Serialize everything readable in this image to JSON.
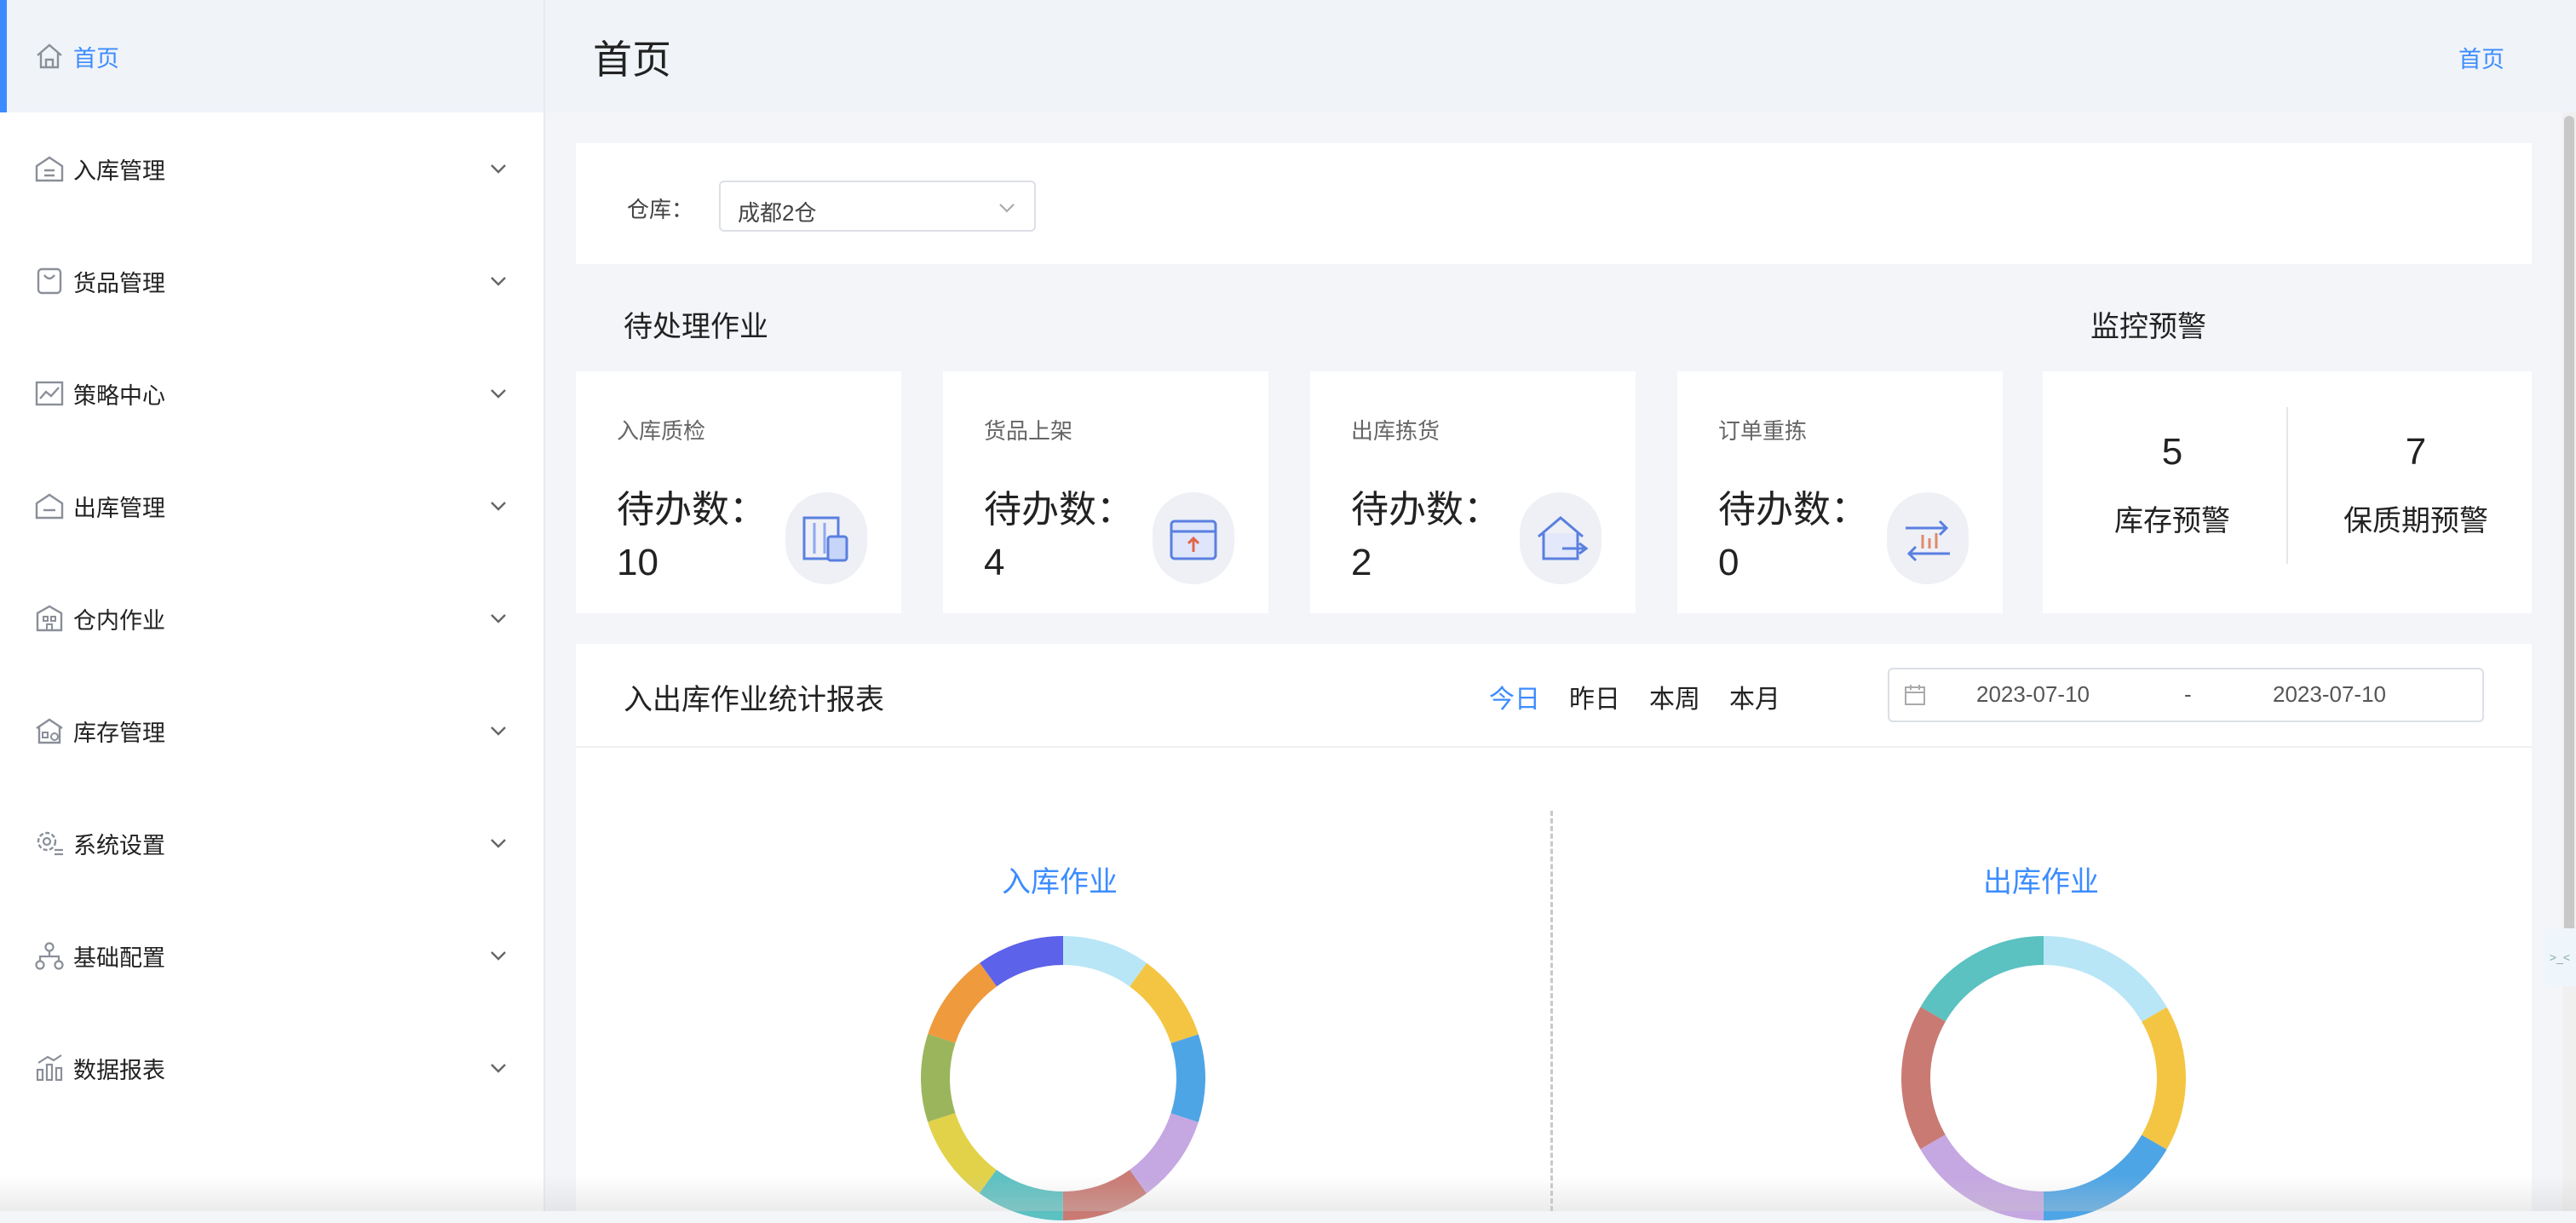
{
  "sidebar": {
    "items": [
      {
        "label": "首页",
        "icon": "home-icon",
        "active": true,
        "has_children": false
      },
      {
        "label": "入库管理",
        "icon": "inbound-icon",
        "active": false,
        "has_children": true
      },
      {
        "label": "货品管理",
        "icon": "bag-icon",
        "active": false,
        "has_children": true
      },
      {
        "label": "策略中心",
        "icon": "chart-line-icon",
        "active": false,
        "has_children": true
      },
      {
        "label": "出库管理",
        "icon": "outbound-icon",
        "active": false,
        "has_children": true
      },
      {
        "label": "仓内作业",
        "icon": "building-icon",
        "active": false,
        "has_children": true
      },
      {
        "label": "库存管理",
        "icon": "warehouse-icon",
        "active": false,
        "has_children": true
      },
      {
        "label": "系统设置",
        "icon": "gear-icon",
        "active": false,
        "has_children": true
      },
      {
        "label": "基础配置",
        "icon": "hierarchy-icon",
        "active": false,
        "has_children": true
      },
      {
        "label": "数据报表",
        "icon": "bar-chart-icon",
        "active": false,
        "has_children": true
      }
    ]
  },
  "header": {
    "title": "首页",
    "breadcrumb": "首页"
  },
  "filter": {
    "label": "仓库：",
    "selected": "成都2仓"
  },
  "pending": {
    "title": "待处理作业",
    "cards": [
      {
        "title": "入库质检",
        "count_text": "待办数：10",
        "count": 10,
        "icon": "inspection-icon"
      },
      {
        "title": "货品上架",
        "count_text": "待办数：4",
        "count": 4,
        "icon": "box-icon"
      },
      {
        "title": "出库拣货",
        "count_text": "待办数：2",
        "count": 2,
        "icon": "house-out-icon"
      },
      {
        "title": "订单重拣",
        "count_text": "待办数：0",
        "count": 0,
        "icon": "repick-icon"
      }
    ]
  },
  "monitor": {
    "title": "监控预警",
    "items": [
      {
        "value": "5",
        "label": "库存预警"
      },
      {
        "value": "7",
        "label": "保质期预警"
      }
    ]
  },
  "report": {
    "title": "入出库作业统计报表",
    "periods": [
      {
        "label": "今日",
        "active": true
      },
      {
        "label": "昨日",
        "active": false
      },
      {
        "label": "本周",
        "active": false
      },
      {
        "label": "本月",
        "active": false
      }
    ],
    "date_start": "2023-07-10",
    "date_separator": "-",
    "date_end": "2023-07-10",
    "charts": [
      {
        "title": "入库作业",
        "segments": [
          {
            "color": "#b8e6f6",
            "value": 1
          },
          {
            "color": "#f4c542",
            "value": 1
          },
          {
            "color": "#4ea5e5",
            "value": 1
          },
          {
            "color": "#c5a7e2",
            "value": 1
          },
          {
            "color": "#c97a73",
            "value": 1
          },
          {
            "color": "#5bc1c1",
            "value": 1
          },
          {
            "color": "#e1d24a",
            "value": 1
          },
          {
            "color": "#9bb55c",
            "value": 1
          },
          {
            "color": "#ef9a3d",
            "value": 1
          },
          {
            "color": "#5d62ea",
            "value": 1
          }
        ]
      },
      {
        "title": "出库作业",
        "segments": [
          {
            "color": "#b8e6f6",
            "value": 1
          },
          {
            "color": "#f4c542",
            "value": 1
          },
          {
            "color": "#4ea5e5",
            "value": 1
          },
          {
            "color": "#c5a7e2",
            "value": 1
          },
          {
            "color": "#c97a73",
            "value": 1
          },
          {
            "color": "#5bc1c1",
            "value": 1
          }
        ]
      }
    ]
  },
  "colors": {
    "accent": "#3c8cff",
    "sidebar_bg": "#ffffff",
    "content_bg": "#f3f5f9"
  }
}
